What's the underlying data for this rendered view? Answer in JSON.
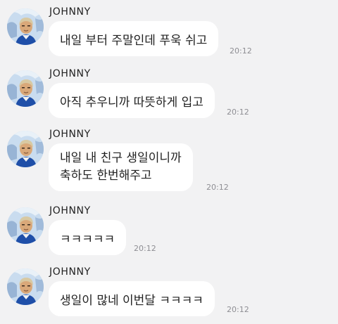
{
  "chat": {
    "messages": [
      {
        "sender": "JOHNNY",
        "text": "내일 부터 주말인데 푸욱 쉬고",
        "time": "20:12"
      },
      {
        "sender": "JOHNNY",
        "text": "아직 추우니까 따뜻하게 입고",
        "time": "20:12"
      },
      {
        "sender": "JOHNNY",
        "lines": [
          "내일 내 친구 생일이니까",
          "축하도 한번해주고"
        ],
        "time": "20:12"
      },
      {
        "sender": "JOHNNY",
        "text": "ㅋㅋㅋㅋㅋ",
        "time": "20:12"
      },
      {
        "sender": "JOHNNY",
        "text": "생일이 많네 이번달 ㅋㅋㅋㅋ",
        "time": "20:12"
      }
    ]
  }
}
